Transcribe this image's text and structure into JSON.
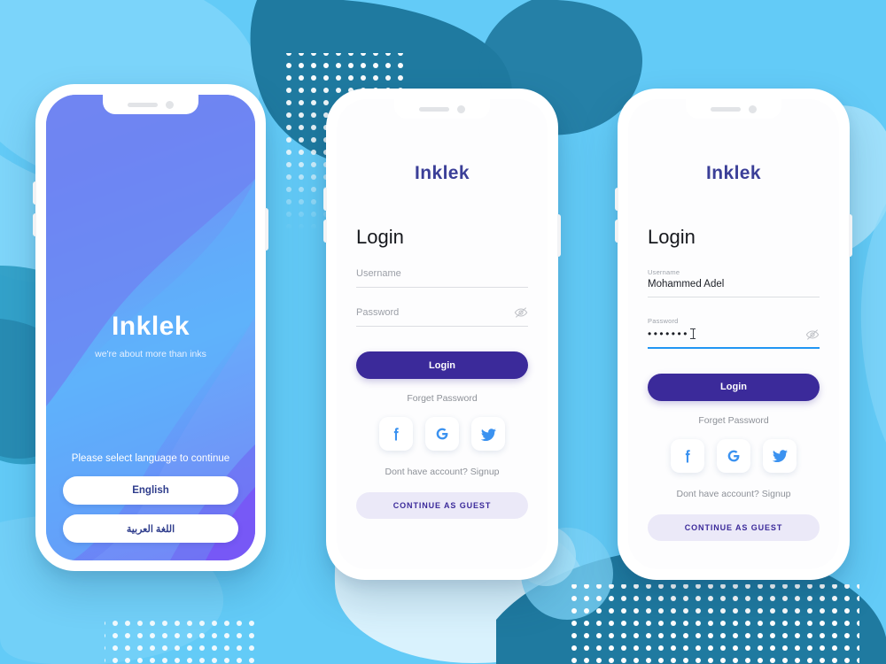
{
  "background": {
    "base_color": "#63cbf7",
    "blob_colors": [
      "#1f7aa0",
      "#2d9dc4",
      "#7fd6fa",
      "#a9e4fb",
      "#dff3fd",
      "#ffffff"
    ],
    "dot_color": "#ffffff"
  },
  "brand": {
    "name": "Inklek",
    "tagline": "we're about more than inks",
    "splash_color": "#ffffff",
    "login_color": "#3b3f98"
  },
  "splash": {
    "prompt": "Please select language to continue",
    "languages": [
      {
        "label": "English",
        "code": "en"
      },
      {
        "label": "اللغة العربية",
        "code": "ar"
      }
    ]
  },
  "login_empty": {
    "title": "Login",
    "username": {
      "label": "Username",
      "placeholder": "Username",
      "value": ""
    },
    "password": {
      "label": "Password",
      "placeholder": "Password",
      "value": "",
      "focused": false
    },
    "eye_icon": "eye-off-icon",
    "login_button": "Login",
    "forget_password": "Forget Password",
    "socials": [
      {
        "name": "facebook-icon",
        "color": "#3b92f0"
      },
      {
        "name": "google-icon",
        "color": "#3b92f0"
      },
      {
        "name": "twitter-icon",
        "color": "#3b92f0"
      }
    ],
    "signup_prompt": "Dont have account? Signup",
    "guest_button": "CONTINUE AS GUEST"
  },
  "login_filled": {
    "title": "Login",
    "username": {
      "label": "Username",
      "value": "Mohammed Adel"
    },
    "password": {
      "label": "Password",
      "value": "•••••••",
      "masked_length": 7,
      "focused": true,
      "focus_color": "#2196f3"
    },
    "eye_icon": "eye-off-icon",
    "login_button": "Login",
    "forget_password": "Forget Password",
    "socials": [
      {
        "name": "facebook-icon",
        "color": "#3b92f0"
      },
      {
        "name": "google-icon",
        "color": "#3b92f0"
      },
      {
        "name": "twitter-icon",
        "color": "#3b92f0"
      }
    ],
    "signup_prompt": "Dont have account? Signup",
    "guest_button": "CONTINUE AS GUEST"
  },
  "theme": {
    "primary": "#3b2a9a",
    "guest_bg": "#ebe9f8",
    "muted_text": "#8d9198",
    "title_text": "#16181d"
  }
}
